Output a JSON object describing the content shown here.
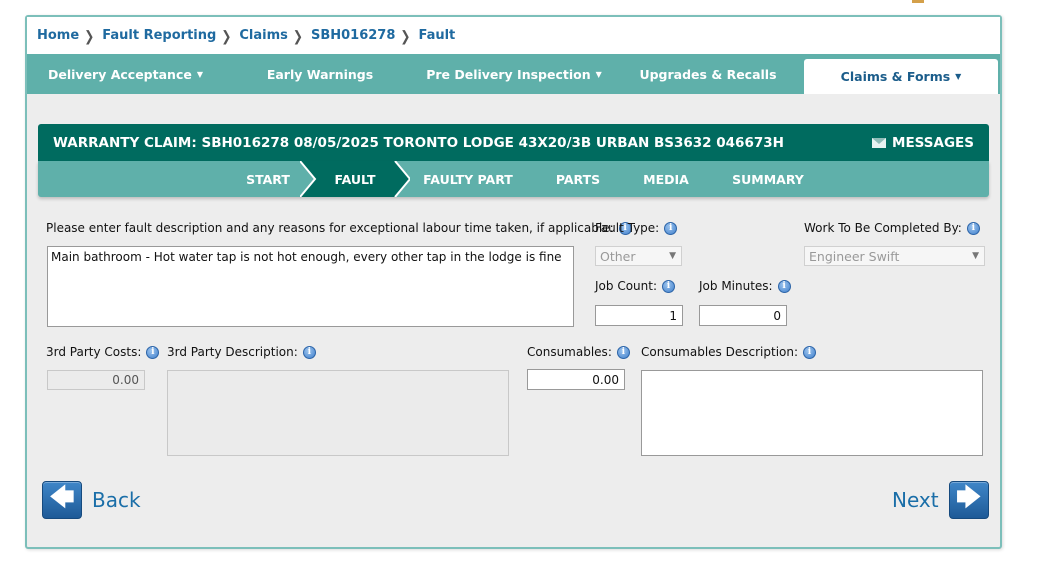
{
  "breadcrumb": [
    "Home",
    "Fault Reporting",
    "Claims",
    "SBH016278",
    "Fault"
  ],
  "nav": {
    "items": [
      {
        "label": "Delivery Acceptance",
        "dropdown": true
      },
      {
        "label": "Early Warnings",
        "dropdown": false
      },
      {
        "label": "Pre Delivery Inspection",
        "dropdown": true
      },
      {
        "label": "Upgrades & Recalls",
        "dropdown": false
      },
      {
        "label": "Claims & Forms",
        "dropdown": true,
        "active": true
      }
    ]
  },
  "claim": {
    "title": "WARRANTY CLAIM: SBH016278 08/05/2025 TORONTO LODGE 43X20/3B URBAN BS3632 046673H",
    "messages_label": "MESSAGES"
  },
  "steps": [
    "START",
    "FAULT",
    "FAULTY PART",
    "PARTS",
    "MEDIA",
    "SUMMARY"
  ],
  "active_step": "FAULT",
  "form": {
    "fault_description_label": "Please enter fault description and any reasons for exceptional labour time taken, if applicable:",
    "fault_description_value": "Main bathroom - Hot water tap is not hot enough, every other tap in the lodge is fine",
    "fault_type_label": "Fault Type:",
    "fault_type_value": "Other",
    "work_by_label": "Work To Be Completed By:",
    "work_by_value": "Engineer Swift",
    "job_count_label": "Job Count:",
    "job_count_value": "1",
    "job_minutes_label": "Job Minutes:",
    "job_minutes_value": "0",
    "third_party_costs_label": "3rd Party Costs:",
    "third_party_costs_value": "0.00",
    "third_party_desc_label": "3rd Party Description:",
    "third_party_desc_value": "",
    "consumables_label": "Consumables:",
    "consumables_value": "0.00",
    "consumables_desc_label": "Consumables Description:",
    "consumables_desc_value": ""
  },
  "buttons": {
    "back_label": "Back",
    "next_label": "Next"
  },
  "colors": {
    "teal_nav": "#5fb0aa",
    "dark_teal": "#006b5f",
    "link_blue": "#1f6aa0"
  }
}
